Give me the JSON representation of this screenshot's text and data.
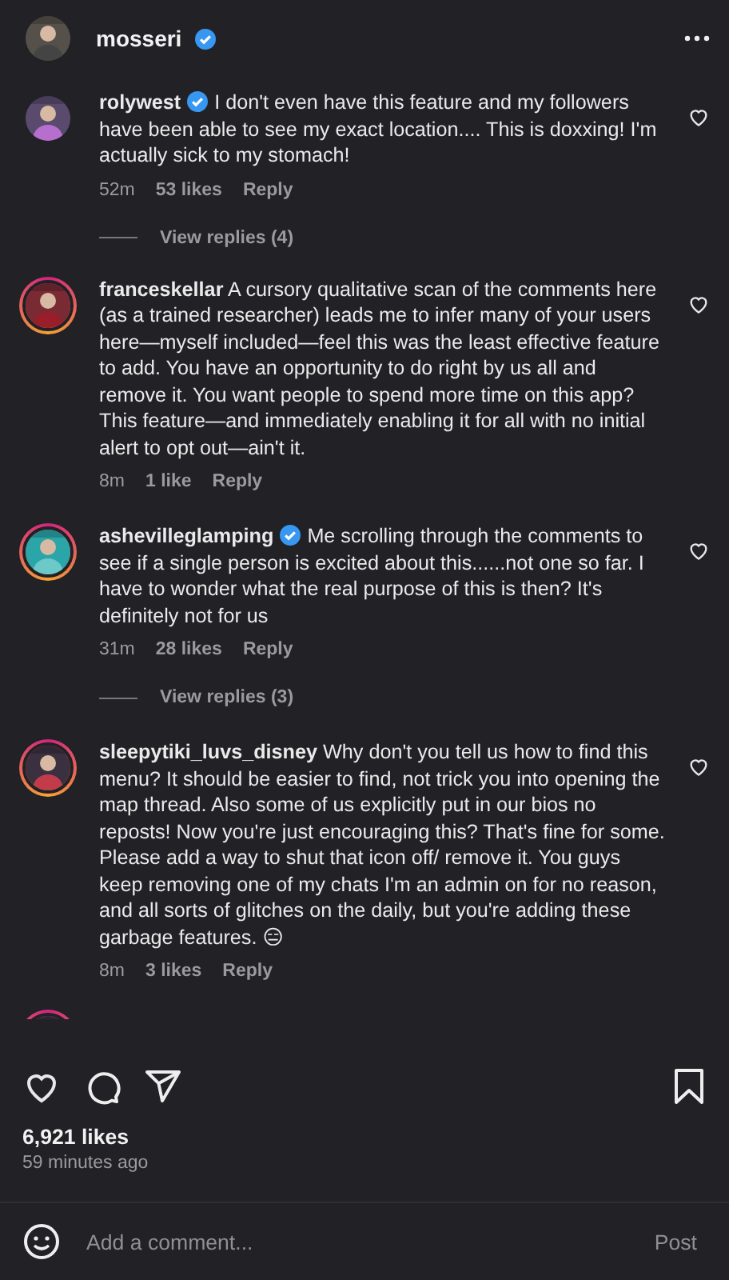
{
  "header": {
    "username": "mosseri",
    "verified": true,
    "story_ring": false
  },
  "comments": [
    {
      "username": "rolywest",
      "verified": true,
      "story_ring": false,
      "text": "I don't even have this feature and my followers have been able to see my exact location.... This is doxxing! I'm actually sick to my stomach!",
      "time": "52m",
      "likes": "53 likes",
      "reply": "Reply",
      "view_replies": "View replies (4)",
      "liked": false
    },
    {
      "username": "franceskellar",
      "verified": false,
      "story_ring": true,
      "text": "A cursory qualitative scan of the comments here (as a trained researcher) leads me to infer many of your users here—myself included—feel this was the least effective feature to add. You have an opportunity to do right by us all and remove it. You want people to spend more time on this app? This feature—and immediately enabling it for all with no initial alert to opt out—ain't it.",
      "time": "8m",
      "likes": "1 like",
      "reply": "Reply",
      "liked": false
    },
    {
      "username": "ashevilleglamping",
      "verified": true,
      "story_ring": true,
      "text": "Me scrolling through the comments to see if a single person is excited about this......not one so far. I have to wonder what the real purpose of this is then? It's definitely not for us",
      "time": "31m",
      "likes": "28 likes",
      "reply": "Reply",
      "view_replies": "View replies (3)",
      "liked": false
    },
    {
      "username": "sleepytiki_luvs_disney",
      "verified": false,
      "story_ring": true,
      "text": "Why don't you tell us how to find this menu? It should be easier to find, not trick you into opening the map thread. Also some of us explicitly put in our bios no reposts! Now you're just encouraging this? That's fine for some. Please add a way to shut that icon off/ remove it. You guys keep removing one of my chats I'm an admin on for no reason, and all sorts of glitches on the daily, but you're adding these garbage features. 😑",
      "time": "8m",
      "likes": "3 likes",
      "reply": "Reply",
      "liked": false
    }
  ],
  "next_comment": {
    "story_ring": true
  },
  "actions": {
    "liked": false,
    "saved": false
  },
  "likes": "6,921 likes",
  "posted": "59 minutes ago",
  "composer": {
    "placeholder": "Add a comment...",
    "post": "Post"
  }
}
